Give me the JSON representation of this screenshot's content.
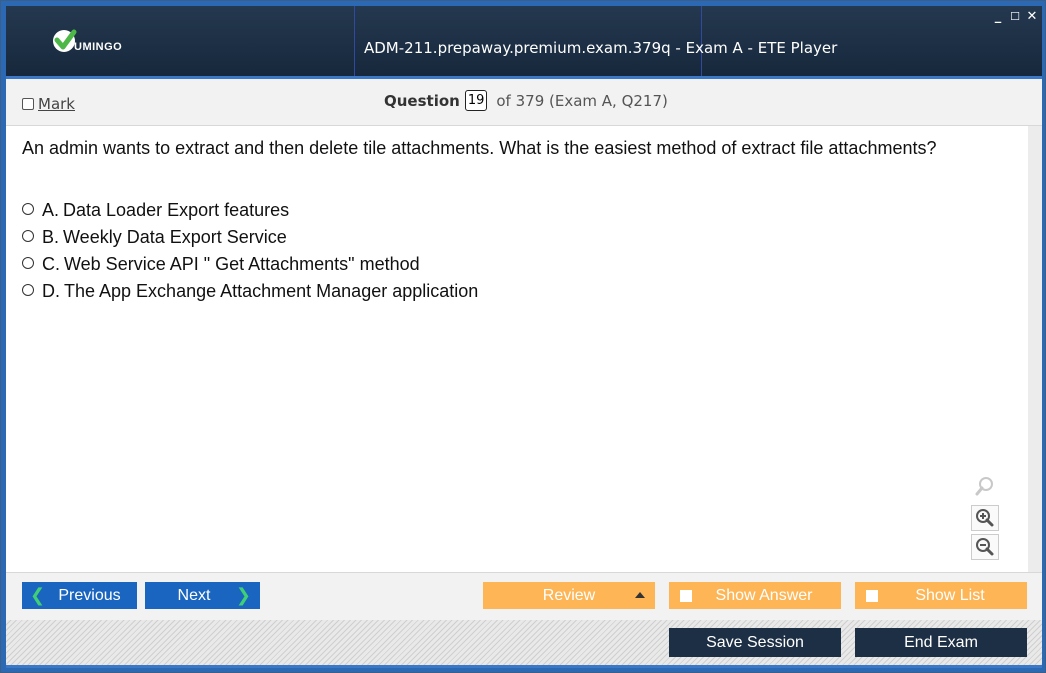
{
  "window": {
    "title": "ADM-211.prepaway.premium.exam.379q - Exam A - ETE Player",
    "logo_text": "UMINGO",
    "controls": {
      "minimize": "_",
      "maximize": "☐",
      "close": "✕"
    }
  },
  "question_bar": {
    "mark_label": "Mark",
    "mark_checked": false,
    "question_label": "Question",
    "question_number": "19",
    "question_total": "of 379 (Exam A, Q217)"
  },
  "question": {
    "text": "An admin wants to extract and then delete tile attachments. What is the easiest method of extract file attachments?",
    "answers": [
      {
        "letter": "A.",
        "text": "Data Loader Export features"
      },
      {
        "letter": "B.",
        "text": "Weekly Data Export Service"
      },
      {
        "letter": "C.",
        "text": "Web Service API \" Get Attachments\" method"
      },
      {
        "letter": "D.",
        "text": "The App Exchange Attachment Manager application"
      }
    ]
  },
  "zoom": {
    "icons": [
      "zoom-reset-icon",
      "zoom-in-icon",
      "zoom-out-icon"
    ]
  },
  "nav": {
    "previous": "Previous",
    "next": "Next",
    "review": "Review",
    "show_answer": "Show Answer",
    "show_list": "Show List"
  },
  "footer": {
    "save_session": "Save Session",
    "end_exam": "End Exam"
  },
  "colors": {
    "titlebar": "#1b2d42",
    "accent_blue": "#1a65bf",
    "orange": "#fdb556",
    "dark_button": "#1d2f45",
    "chevron_green": "#3fcf77",
    "logo_green": "#4db848"
  }
}
